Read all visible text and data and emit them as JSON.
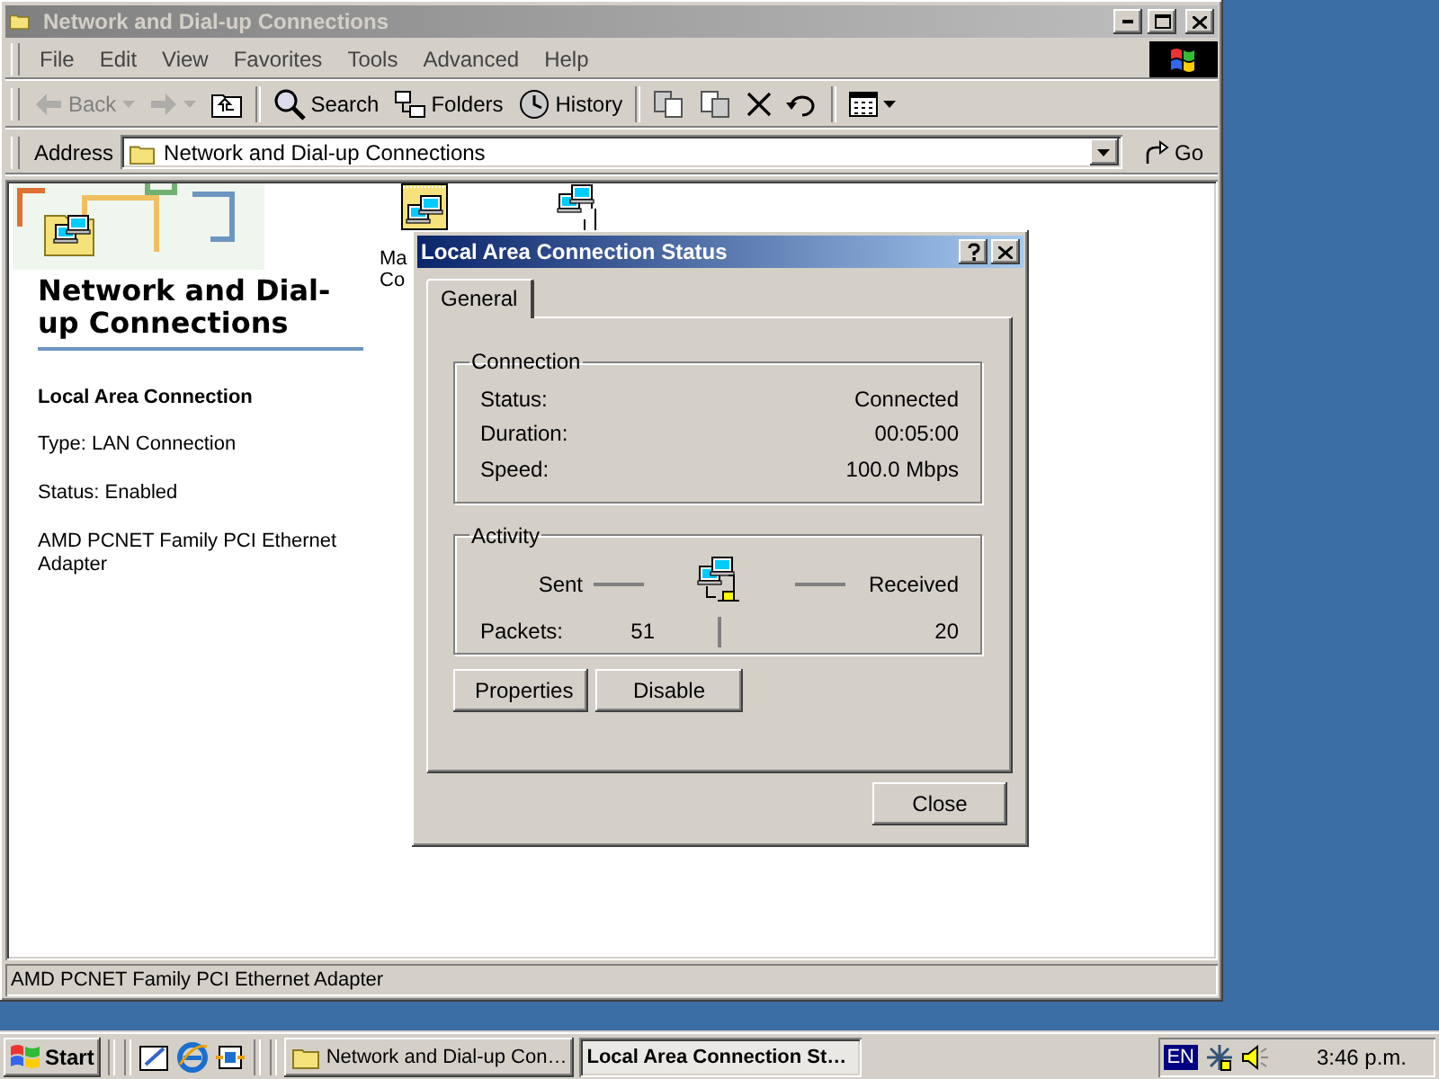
{
  "window": {
    "title": "Network and Dial-up Connections",
    "active": false
  },
  "menu": [
    "File",
    "Edit",
    "View",
    "Favorites",
    "Tools",
    "Advanced",
    "Help"
  ],
  "toolbar": [
    {
      "kind": "back",
      "label": "Back",
      "disabled": true
    },
    {
      "kind": "forward",
      "disabled": true
    },
    {
      "kind": "up",
      "disabled": false
    },
    {
      "kind": "search",
      "label": "Search",
      "disabled": false
    },
    {
      "kind": "folders",
      "label": "Folders",
      "disabled": false
    },
    {
      "kind": "history",
      "label": "History",
      "disabled": false
    },
    {
      "kind": "move",
      "disabled": false
    },
    {
      "kind": "copy",
      "disabled": false
    },
    {
      "kind": "delete",
      "disabled": false
    },
    {
      "kind": "undo",
      "disabled": false
    },
    {
      "kind": "views",
      "disabled": false
    }
  ],
  "address": {
    "label": "Address",
    "value": "Network and Dial-up Connections",
    "go": "Go"
  },
  "info_pane": {
    "heading": "Network and Dial-up Connections",
    "selection_title": "Local Area Connection",
    "details": [
      "Type: LAN Connection",
      "Status: Enabled",
      "AMD PCNET Family PCI Ethernet Adapter"
    ]
  },
  "icons": [
    {
      "kind": "new-connection",
      "label": [
        "Ma",
        "Co"
      ]
    },
    {
      "kind": "lan"
    }
  ],
  "status_bar": "AMD PCNET Family PCI Ethernet Adapter",
  "dialog": {
    "title": "Local Area Connection Status",
    "active": true,
    "tabs": [
      {
        "label": "General",
        "selected": true
      }
    ],
    "connection": {
      "title": "Connection",
      "rows": [
        {
          "label": "Status:",
          "value": "Connected"
        },
        {
          "label": "Duration:",
          "value": "00:05:00"
        },
        {
          "label": "Speed:",
          "value": "100.0 Mbps"
        }
      ]
    },
    "activity": {
      "title": "Activity",
      "sent": "Sent",
      "received": "Received",
      "rows": [
        {
          "label": "Packets:",
          "sent": "51",
          "received": "20"
        }
      ]
    },
    "buttons": [
      "Properties",
      "Disable"
    ],
    "close": "Close"
  },
  "taskbar": {
    "start": "Start",
    "quick_launch": [
      {
        "kind": "desktop"
      },
      {
        "kind": "browser"
      },
      {
        "kind": "channels"
      }
    ],
    "tasks": [
      {
        "label": "Network and Dial-up Con…",
        "kind": "folder",
        "selected": false
      },
      {
        "label": "Local Area Connection St…",
        "kind": "none",
        "selected": true
      }
    ],
    "language": "EN",
    "clock": "3:46 p.m."
  }
}
